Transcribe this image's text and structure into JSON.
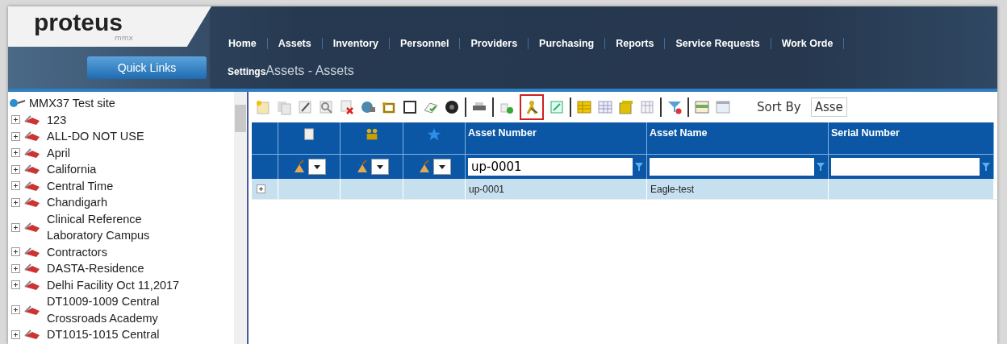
{
  "logo": {
    "name": "proteus",
    "sub": "mmx"
  },
  "nav": [
    "Home",
    "Assets",
    "Inventory",
    "Personnel",
    "Providers",
    "Purchasing",
    "Reports",
    "Service Requests",
    "Work Orde"
  ],
  "quick_links": "Quick Links",
  "breadcrumb": {
    "settings": "Settings",
    "path": "Assets - Assets"
  },
  "tree": {
    "root": "MMX37 Test site",
    "items": [
      {
        "label": "123",
        "expanded": false
      },
      {
        "label": "ALL-DO NOT USE",
        "expanded": false
      },
      {
        "label": "April",
        "expanded": false
      },
      {
        "label": "California",
        "expanded": false
      },
      {
        "label": "Central Time",
        "expanded": false
      },
      {
        "label": "Chandigarh",
        "expanded": false
      },
      {
        "label": "Clinical Reference Laboratory Campus",
        "expanded": false
      },
      {
        "label": "Contractors",
        "expanded": false
      },
      {
        "label": "DASTA-Residence",
        "expanded": false
      },
      {
        "label": "Delhi Facility Oct 11,2017",
        "expanded": false
      },
      {
        "label": "DT1009-1009 Central Crossroads Academy",
        "expanded": false
      },
      {
        "label": "DT1015-1015 Central",
        "expanded": false
      }
    ]
  },
  "toolbar": {
    "tools": [
      {
        "highlighted": false
      },
      {
        "highlighted": false
      },
      {
        "highlighted": false
      },
      {
        "highlighted": false
      },
      {
        "highlighted": false
      },
      {
        "highlighted": false
      },
      {
        "highlighted": false
      },
      {
        "highlighted": false
      },
      {
        "highlighted": false
      },
      {
        "highlighted": false
      },
      {
        "highlighted": false
      },
      {
        "highlighted": false
      },
      {
        "highlighted": true
      },
      {
        "highlighted": false
      },
      {
        "highlighted": false
      },
      {
        "highlighted": false
      },
      {
        "highlighted": false
      },
      {
        "highlighted": false
      },
      {
        "highlighted": false
      },
      {
        "highlighted": false
      },
      {
        "highlighted": false
      }
    ],
    "sort_label": "Sort By",
    "sort_value": "Asse"
  },
  "table": {
    "columns": [
      {
        "label": "Asset Number",
        "filter": "up-0001"
      },
      {
        "label": "Asset Name"
      },
      {
        "label": "Serial Number"
      }
    ],
    "rows": [
      {
        "expanded": false,
        "cells": [
          "up-0001",
          "Eagle-test"
        ]
      }
    ]
  }
}
